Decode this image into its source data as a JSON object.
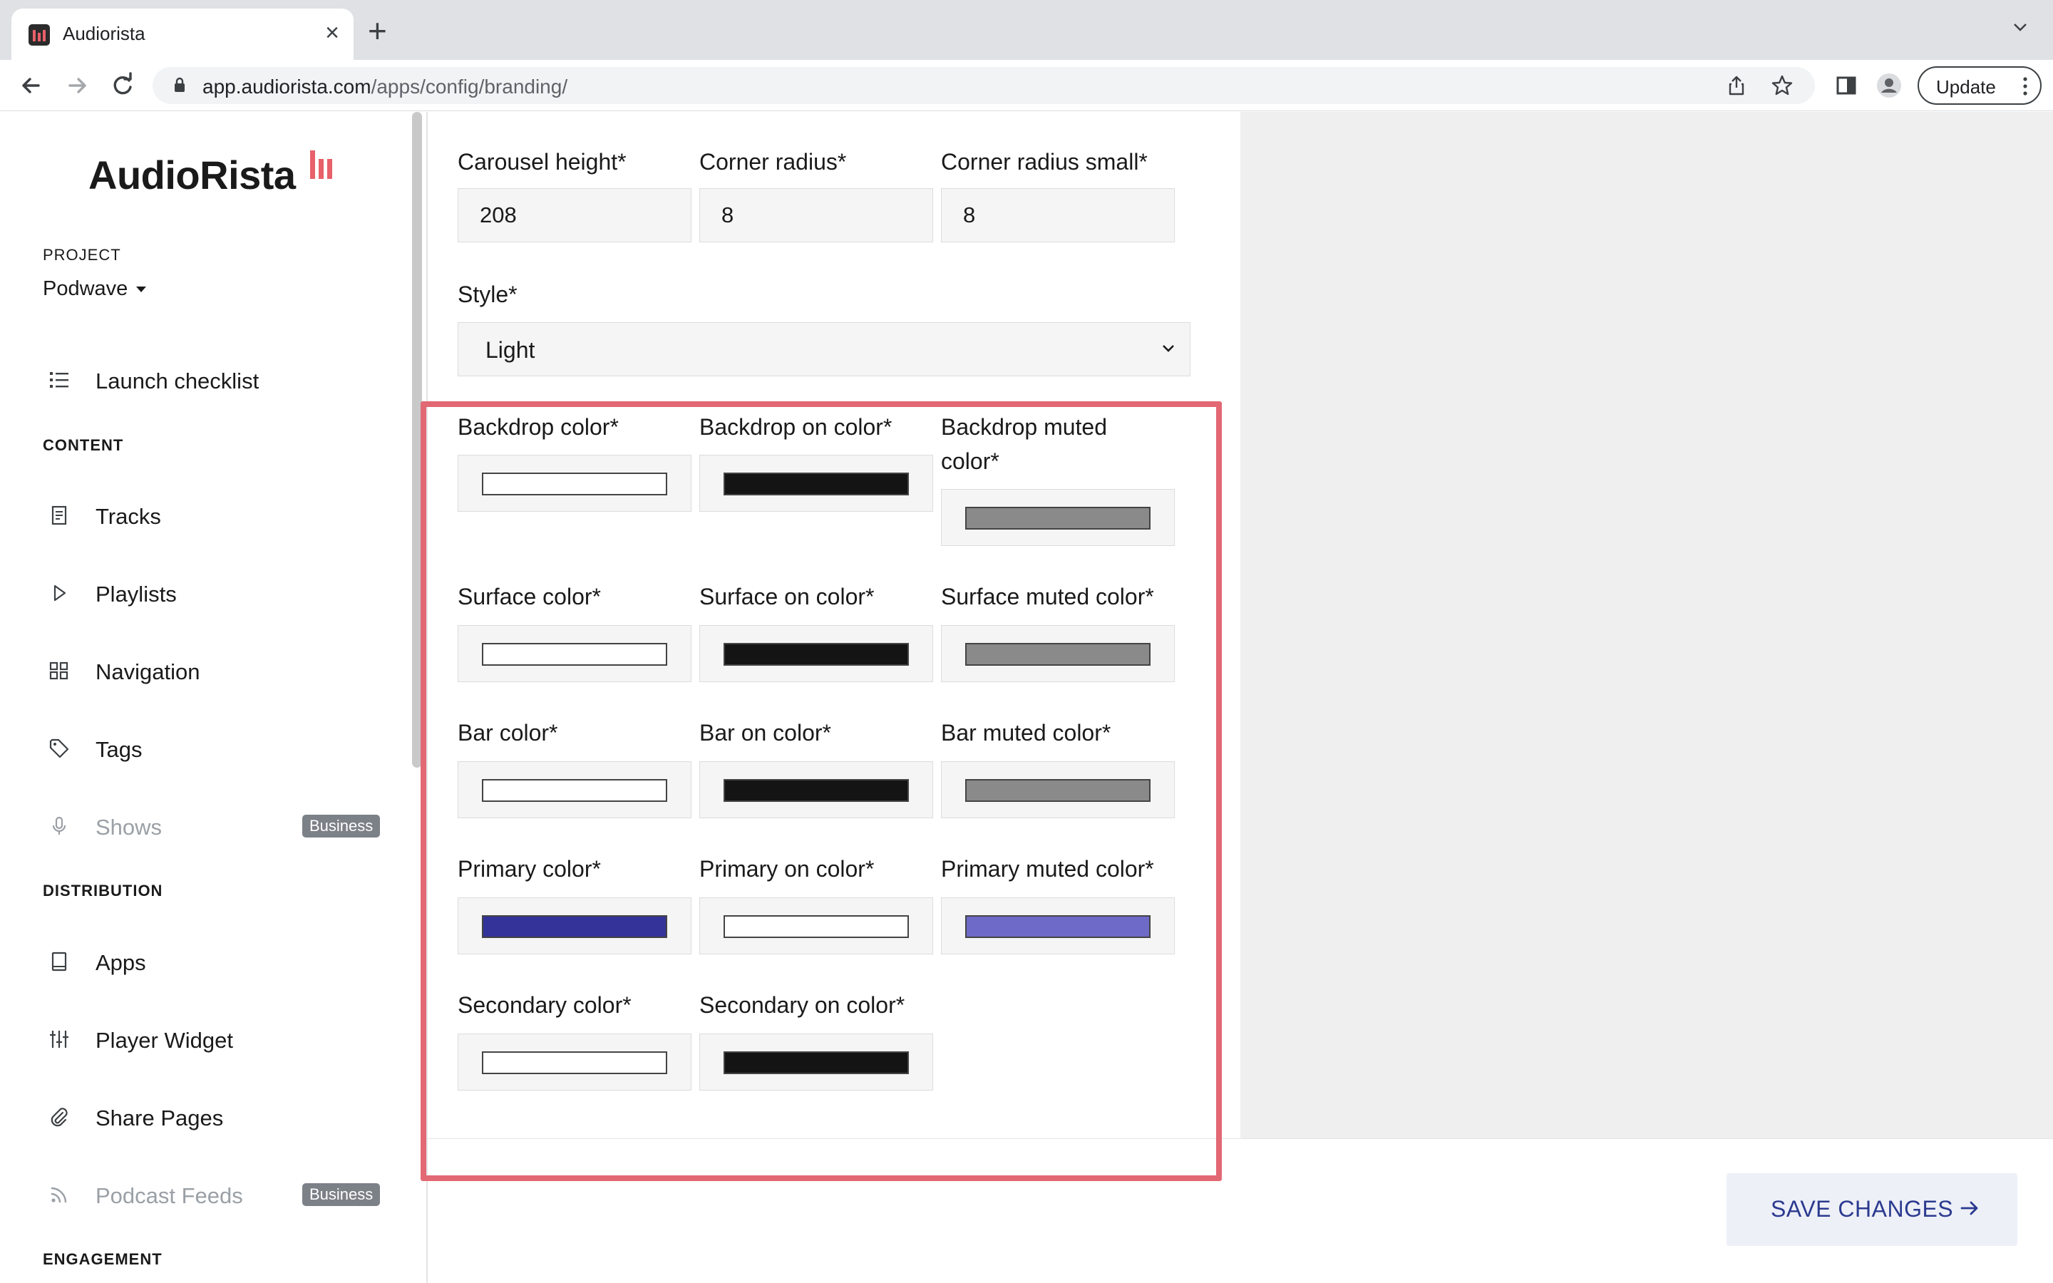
{
  "browser": {
    "tab_title": "Audiorista",
    "url_domain": "app.audiorista.com",
    "url_path": "/apps/config/branding/",
    "update_label": "Update"
  },
  "sidebar": {
    "logo_text": "AudioRista",
    "project_label": "PROJECT",
    "project_name": "Podwave",
    "launch_checklist": "Launch checklist",
    "sections": {
      "content": "CONTENT",
      "distribution": "DISTRIBUTION",
      "engagement": "ENGAGEMENT"
    },
    "content_items": [
      {
        "label": "Tracks",
        "icon": "document-icon"
      },
      {
        "label": "Playlists",
        "icon": "play-icon"
      },
      {
        "label": "Navigation",
        "icon": "grid-icon"
      },
      {
        "label": "Tags",
        "icon": "tag-icon"
      },
      {
        "label": "Shows",
        "icon": "microphone-icon",
        "badge": "Business",
        "disabled": true
      }
    ],
    "distribution_items": [
      {
        "label": "Apps",
        "icon": "tablet-icon"
      },
      {
        "label": "Player Widget",
        "icon": "sliders-icon"
      },
      {
        "label": "Share Pages",
        "icon": "paperclip-icon"
      },
      {
        "label": "Podcast Feeds",
        "icon": "rss-icon",
        "badge": "Business",
        "disabled": true
      }
    ]
  },
  "form": {
    "carousel_height": {
      "label": "Carousel height*",
      "value": "208"
    },
    "corner_radius": {
      "label": "Corner radius*",
      "value": "8"
    },
    "corner_radius_small": {
      "label": "Corner radius small*",
      "value": "8"
    },
    "style": {
      "label": "Style*",
      "value": "Light"
    },
    "colors": {
      "backdrop": {
        "label": "Backdrop color*",
        "value": "#FFFFFF"
      },
      "backdrop_on": {
        "label": "Backdrop on color*",
        "value": "#141414"
      },
      "backdrop_muted": {
        "label_line1": "Backdrop muted",
        "label_line2": "color*",
        "value": "#8A8A8A"
      },
      "surface": {
        "label": "Surface color*",
        "value": "#FFFFFF"
      },
      "surface_on": {
        "label": "Surface on color*",
        "value": "#141414"
      },
      "surface_muted": {
        "label": "Surface muted color*",
        "value": "#8A8A8A"
      },
      "bar": {
        "label": "Bar color*",
        "value": "#FFFFFF"
      },
      "bar_on": {
        "label": "Bar on color*",
        "value": "#141414"
      },
      "bar_muted": {
        "label": "Bar muted color*",
        "value": "#8A8A8A"
      },
      "primary": {
        "label": "Primary color*",
        "value": "#33339A"
      },
      "primary_on": {
        "label": "Primary on color*",
        "value": "#FFFFFF"
      },
      "primary_muted": {
        "label": "Primary muted color*",
        "value": "#6E6AC8"
      },
      "secondary": {
        "label": "Secondary color*",
        "value": "#FFFFFF"
      },
      "secondary_on": {
        "label": "Secondary on color*",
        "value": "#141414"
      }
    }
  },
  "actions": {
    "save_label": "SAVE CHANGES"
  },
  "theme": {
    "accent": "#e8606a",
    "highlight_border": "#e26874",
    "save_text": "#2b3a8f"
  }
}
